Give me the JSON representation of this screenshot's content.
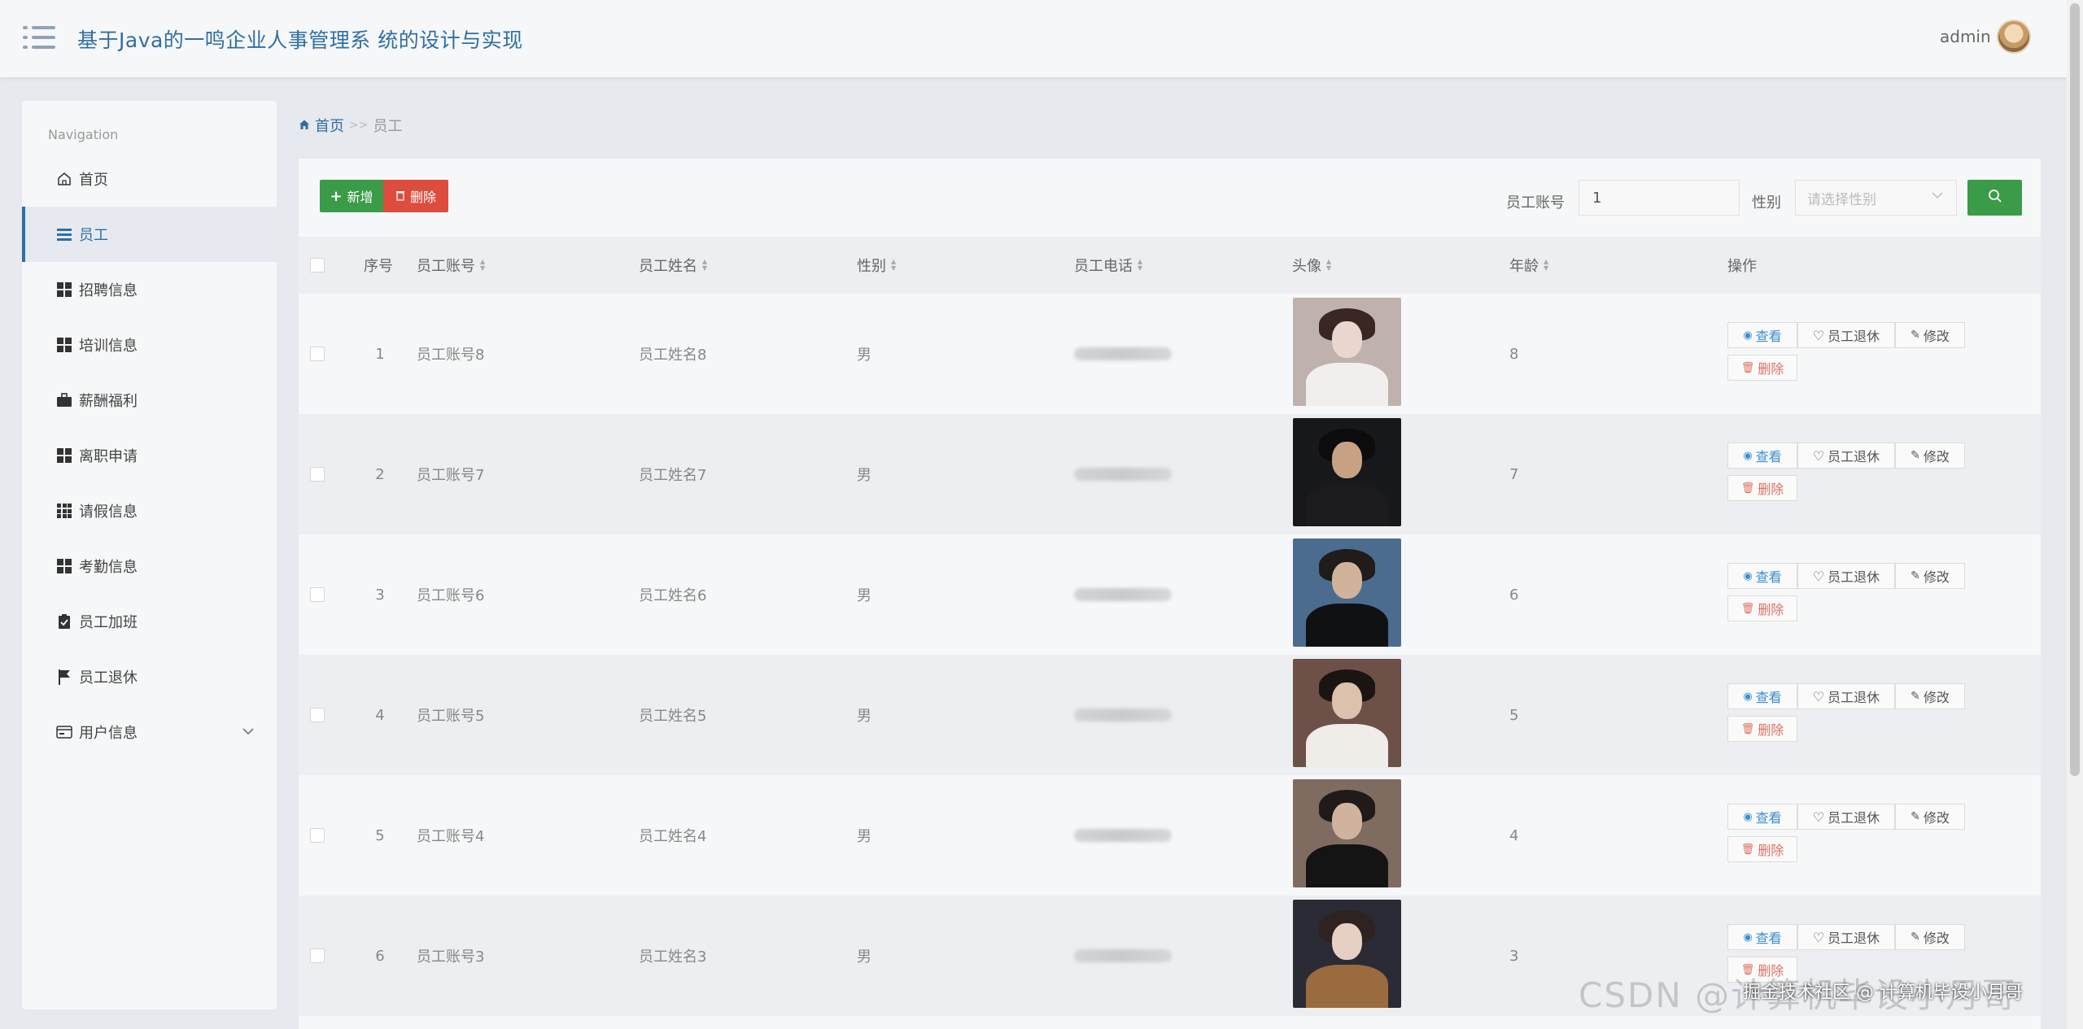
{
  "header": {
    "title": "基于Java的一鸣企业人事管理系 统的设计与实现",
    "user": "admin"
  },
  "sidebar": {
    "caption": "Navigation",
    "items": [
      {
        "label": "首页",
        "icon": "home-icon"
      },
      {
        "label": "员工",
        "icon": "list-icon"
      },
      {
        "label": "招聘信息",
        "icon": "grid-icon"
      },
      {
        "label": "培训信息",
        "icon": "grid-icon"
      },
      {
        "label": "薪酬福利",
        "icon": "briefcase-icon"
      },
      {
        "label": "离职申请",
        "icon": "grid-icon"
      },
      {
        "label": "请假信息",
        "icon": "grid9-icon"
      },
      {
        "label": "考勤信息",
        "icon": "grid-icon"
      },
      {
        "label": "员工加班",
        "icon": "clipboard-icon"
      },
      {
        "label": "员工退休",
        "icon": "flag-icon"
      },
      {
        "label": "用户信息",
        "icon": "wallet-icon"
      }
    ]
  },
  "breadcrumb": {
    "home": "首页",
    "sep": ">>",
    "current": "员工"
  },
  "toolbar": {
    "add_label": "新增",
    "delete_label": "删除",
    "account_label": "员工账号",
    "account_value": "1",
    "gender_label": "性别",
    "gender_placeholder": "请选择性别"
  },
  "table": {
    "headers": [
      "序号",
      "员工账号",
      "员工姓名",
      "性别",
      "员工电话",
      "头像",
      "年龄",
      "操作"
    ],
    "rows": [
      {
        "no": "1",
        "account": "员工账号8",
        "name": "员工姓名8",
        "gender": "男",
        "age": "8"
      },
      {
        "no": "2",
        "account": "员工账号7",
        "name": "员工姓名7",
        "gender": "男",
        "age": "7"
      },
      {
        "no": "3",
        "account": "员工账号6",
        "name": "员工姓名6",
        "gender": "男",
        "age": "6"
      },
      {
        "no": "4",
        "account": "员工账号5",
        "name": "员工姓名5",
        "gender": "男",
        "age": "5"
      },
      {
        "no": "5",
        "account": "员工账号4",
        "name": "员工姓名4",
        "gender": "男",
        "age": "4"
      },
      {
        "no": "6",
        "account": "员工账号3",
        "name": "员工姓名3",
        "gender": "男",
        "age": "3"
      }
    ],
    "actions": {
      "view": "查看",
      "retire": "员工退休",
      "edit": "修改",
      "delete": "删除"
    }
  },
  "watermark": {
    "big": "CSDN @计算机毕设小月哥",
    "small": "掘金技术社区 @ 计算机毕设小月哥"
  },
  "colors": {
    "primary": "#2f6fa4",
    "success": "#3a9b48",
    "danger": "#de4c3d"
  }
}
